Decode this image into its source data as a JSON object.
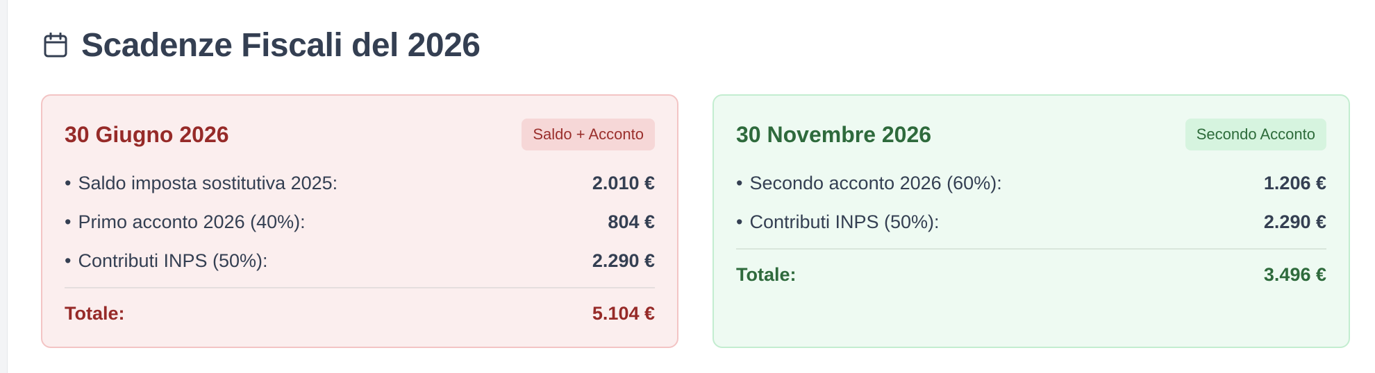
{
  "header": {
    "icon": "calendar-icon",
    "title": "Scadenze Fiscali del 2026"
  },
  "colors": {
    "title": "#343f52",
    "june_accent": "#962a28",
    "june_background": "#fbeeee",
    "june_border": "#f3c4c4",
    "november_accent": "#2e6a3c",
    "november_background": "#eefaf2",
    "november_border": "#c3edd0"
  },
  "cards": [
    {
      "date": "30 Giugno 2026",
      "badge": "Saldo + Acconto",
      "items": [
        {
          "bullet": "•",
          "label": "Saldo imposta sostitutiva 2025:",
          "value": "2.010 €"
        },
        {
          "bullet": "•",
          "label": "Primo acconto 2026 (40%):",
          "value": "804 €"
        },
        {
          "bullet": "•",
          "label": "Contributi INPS (50%):",
          "value": "2.290 €"
        }
      ],
      "total_label": "Totale:",
      "total_value": "5.104 €"
    },
    {
      "date": "30 Novembre 2026",
      "badge": "Secondo Acconto",
      "items": [
        {
          "bullet": "•",
          "label": "Secondo acconto 2026 (60%):",
          "value": "1.206 €"
        },
        {
          "bullet": "•",
          "label": "Contributi INPS (50%):",
          "value": "2.290 €"
        }
      ],
      "total_label": "Totale:",
      "total_value": "3.496 €"
    }
  ]
}
